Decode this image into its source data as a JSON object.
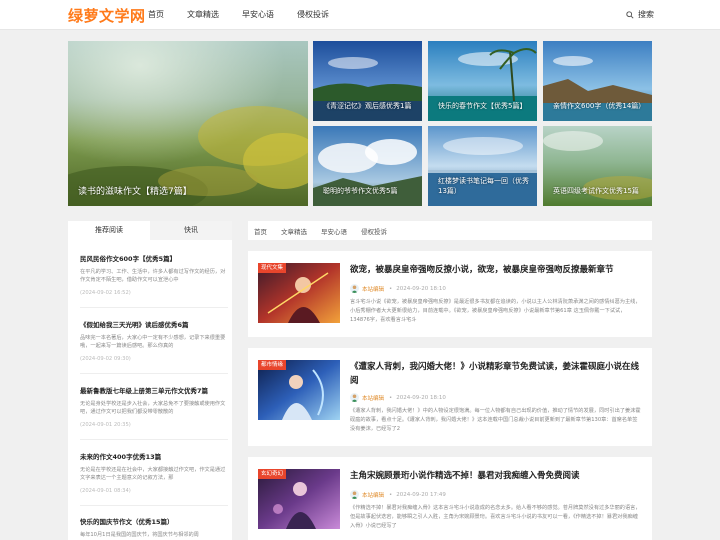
{
  "header": {
    "logo": "绿萝文学网",
    "nav": [
      "首页",
      "文章精选",
      "早安心语",
      "侵权投诉"
    ],
    "search_label": "搜索"
  },
  "hero": {
    "main": {
      "caption": "读书的滋味作文【精选7篇】"
    },
    "tiles": [
      {
        "caption": "《青涩记忆》观后感优秀1篇"
      },
      {
        "caption": "快乐的春节作文【优秀5篇】"
      },
      {
        "caption": "亲情作文600字（优秀14篇）"
      },
      {
        "caption": "聪明的爷爷作文优秀5篇"
      },
      {
        "caption": "红楼梦读书笔记每一回（优秀13篇）"
      },
      {
        "caption": "英语四级考试作文优秀15篇"
      }
    ]
  },
  "sidebar": {
    "tabs": [
      "推荐阅读",
      "快讯"
    ],
    "items": [
      {
        "title": "民风民俗作文600字【优秀5篇】",
        "desc": "在平凡的学习、工作、生活中，许多人都有过写作文的经历，对作文肯定不陌生吧，借助作文可以宣泄心中",
        "date": "(2024-09-02 16:52)"
      },
      {
        "title": "《假如给我三天光明》读后感优秀6篇",
        "desc": "品味完一本名著后，大家心中一定有不少感想，记录下来很重要哦，一起来写一篇读后感吧。那么你真的",
        "date": "(2024-09-02 09:30)"
      },
      {
        "title": "最新鲁教版七年级上册第三单元作文优秀7篇",
        "desc": "无论是身处学校还是步入社会，大家总免不了要接触或使用作文吧，通过作文可以把我们都没带零散散的",
        "date": "(2024-09-01 20:35)"
      },
      {
        "title": "未来的作文400字优秀13篇",
        "desc": "无论是在学校还是在社会中，大家都接触过作文吧，作文是通过文字来表达一个主题意义的记叙方法，那",
        "date": "(2024-09-01 08:34)"
      },
      {
        "title": "快乐的国庆节作文（优秀15篇）",
        "desc": "每年10月1日是我国的国庆节，将国庆节与相邻的周",
        "date": ""
      }
    ]
  },
  "crumbs": [
    "首页",
    "文章精选",
    "早安心语",
    "侵权投诉"
  ],
  "articles": [
    {
      "badge": "现代文集",
      "badge_color": "#e8452c",
      "title": "欲宠，被暴戾皇帝强吻反撩小说，欲宠，被暴戾皇帝强吻反撩最新章节",
      "author": "本站编辑",
      "date": "2024-09-20 18:10",
      "excerpt": "言斗宅斗小说《欲宠，被暴戾皇帝强吻反撩》是最近很多书友都在追读的，小说以主人公林清阮萧承渊之间的感情纠葛为主线，小后秀棚作者大大更新很给力，目前连载中。《欲宠，被暴戾皇帝强吻反撩》小说最新章节第61章 这玉佩你戴一下试试，134876字，喜欢看言斗宅斗"
    },
    {
      "badge": "都市情缘",
      "badge_color": "#e8452c",
      "title": "《遭家人背刺，我闪婚大佬！》小说精彩章节免费试读，姜沫霍砚庭小说在线阅",
      "author": "本站编辑",
      "date": "2024-09-20 18:10",
      "excerpt": "《遭家人背刺，我闪婚大佬！》中的人物设定很饱满。每一位人物都有自己出现的价值，推动了情节的发展，同时引出了姜沫霍砚庭的故事，看点十足。《遭家人背刺，我闪婚大佬！》这本连载中国门总裁小说目前更新到了最新章节第130章：首席名单签没有姜沫，已经写了2"
    },
    {
      "badge": "玄幻奇幻",
      "badge_color": "#e8452c",
      "title": "主角宋婉顾景珩小说作精选不掉！暴君对我痴缠入骨免费阅读",
      "author": "本站编辑",
      "date": "2024-09-20 17:49",
      "excerpt": "《作精选不掉！暴君对我痴缠入骨》这本言斗宅斗小说造成的名念太多。给人看不够的感觉。苍月牌莫然没有过多华丽的语言，但是故事起伏迭宕，能够瞬之引人入胜，主角为宋婉顾景珩。喜欢言斗宅斗小说的书友可以一看，《作精选不掉！暴君对我痴缠入骨》小说已经写了"
    }
  ]
}
